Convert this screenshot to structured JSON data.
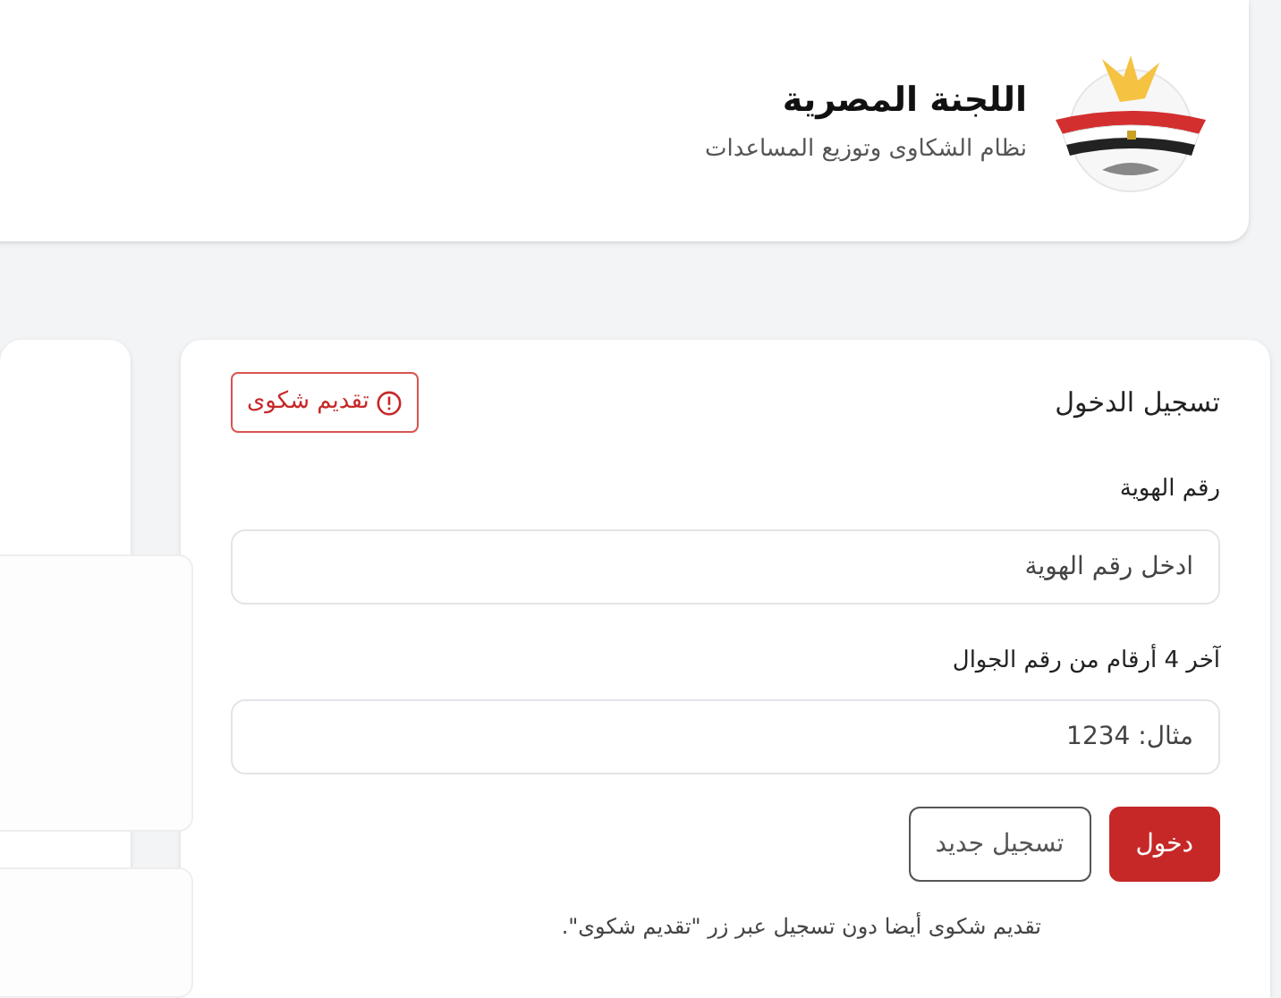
{
  "header": {
    "title": "اللجنة المصرية",
    "subtitle": "نظام الشكاوى وتوزيع المساعدات"
  },
  "login": {
    "title": "تسجيل الدخول",
    "complaint_button": "تقديم شكوى",
    "fields": [
      {
        "label": "رقم الهوية",
        "placeholder": "ادخل رقم الهوية"
      },
      {
        "label": "آخر 4 أرقام من رقم الجوال",
        "placeholder": "مثال: 1234"
      }
    ],
    "buttons": [
      {
        "label": "دخول",
        "kind": "primary"
      },
      {
        "label": "تسجيل جديد",
        "kind": "outline"
      }
    ],
    "note": "تقديم شكوى أيضا دون تسجيل عبر زر \"تقديم شكوى\"."
  }
}
